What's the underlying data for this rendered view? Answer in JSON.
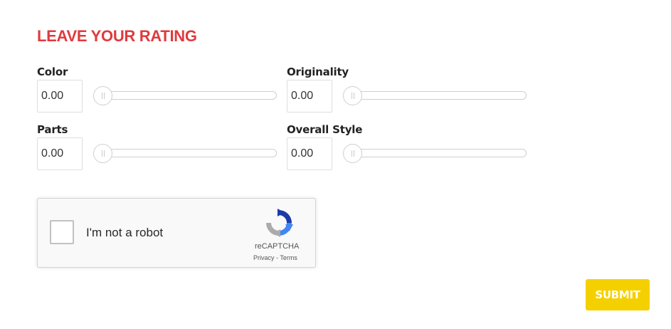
{
  "form": {
    "heading": "LEAVE YOUR RATING",
    "ratings": [
      {
        "label": "Color",
        "value": "0.00",
        "slider_fraction": 0
      },
      {
        "label": "Originality",
        "value": "0.00",
        "slider_fraction": 0
      },
      {
        "label": "Parts",
        "value": "0.00",
        "slider_fraction": 0
      },
      {
        "label": "Overall Style",
        "value": "0.00",
        "slider_fraction": 0
      }
    ],
    "submit_label": "SUBMIT"
  },
  "recaptcha": {
    "label": "I'm not a robot",
    "brand": "reCAPTCHA",
    "privacy": "Privacy",
    "separator": "-",
    "terms": "Terms"
  },
  "colors": {
    "heading": "#e03a3e",
    "submit_bg": "#f5d000",
    "submit_text": "#ffffff"
  },
  "icons": {
    "recaptcha_logo": "recaptcha-logo-icon",
    "slider_handle": "slider-handle-icon"
  }
}
